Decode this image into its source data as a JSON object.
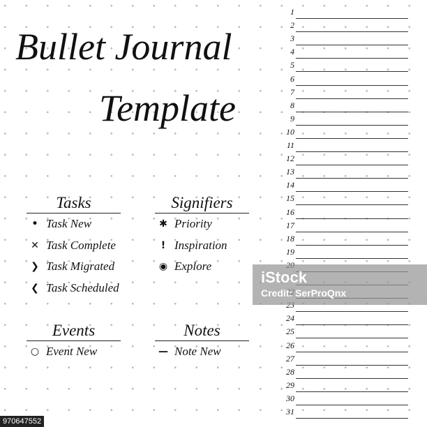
{
  "title": {
    "line1": "Bullet Journal",
    "line2": "Template"
  },
  "sections": {
    "tasks": {
      "heading": "Tasks",
      "items": [
        {
          "symbol": "•",
          "icon": "bullet-dot-icon",
          "label": "Task New"
        },
        {
          "symbol": "✕",
          "icon": "cross-icon",
          "label": "Task Complete"
        },
        {
          "symbol": "❯",
          "icon": "chevron-right-icon",
          "label": "Task Migrated"
        },
        {
          "symbol": "❮",
          "icon": "chevron-left-icon",
          "label": "Task Scheduled"
        }
      ]
    },
    "signifiers": {
      "heading": "Signifiers",
      "items": [
        {
          "symbol": "✱",
          "icon": "asterisk-icon",
          "label": "Priority"
        },
        {
          "symbol": "!",
          "icon": "exclamation-icon",
          "label": "Inspiration"
        },
        {
          "symbol": "◉",
          "icon": "eye-icon",
          "label": "Explore"
        }
      ]
    },
    "events": {
      "heading": "Events",
      "items": [
        {
          "symbol": "○",
          "icon": "circle-icon",
          "label": "Event New"
        }
      ]
    },
    "notes": {
      "heading": "Notes",
      "items": [
        {
          "symbol": "—",
          "icon": "dash-icon",
          "label": "Note New"
        }
      ]
    }
  },
  "days": [
    "1",
    "2",
    "3",
    "4",
    "5",
    "6",
    "7",
    "8",
    "9",
    "10",
    "11",
    "12",
    "13",
    "14",
    "15",
    "16",
    "17",
    "18",
    "19",
    "20",
    "21",
    "22",
    "23",
    "24",
    "25",
    "26",
    "27",
    "28",
    "29",
    "30",
    "31"
  ],
  "watermark": {
    "brand": "iStock",
    "credit": "Credit: SerProQnx"
  },
  "image_id": "970647552"
}
